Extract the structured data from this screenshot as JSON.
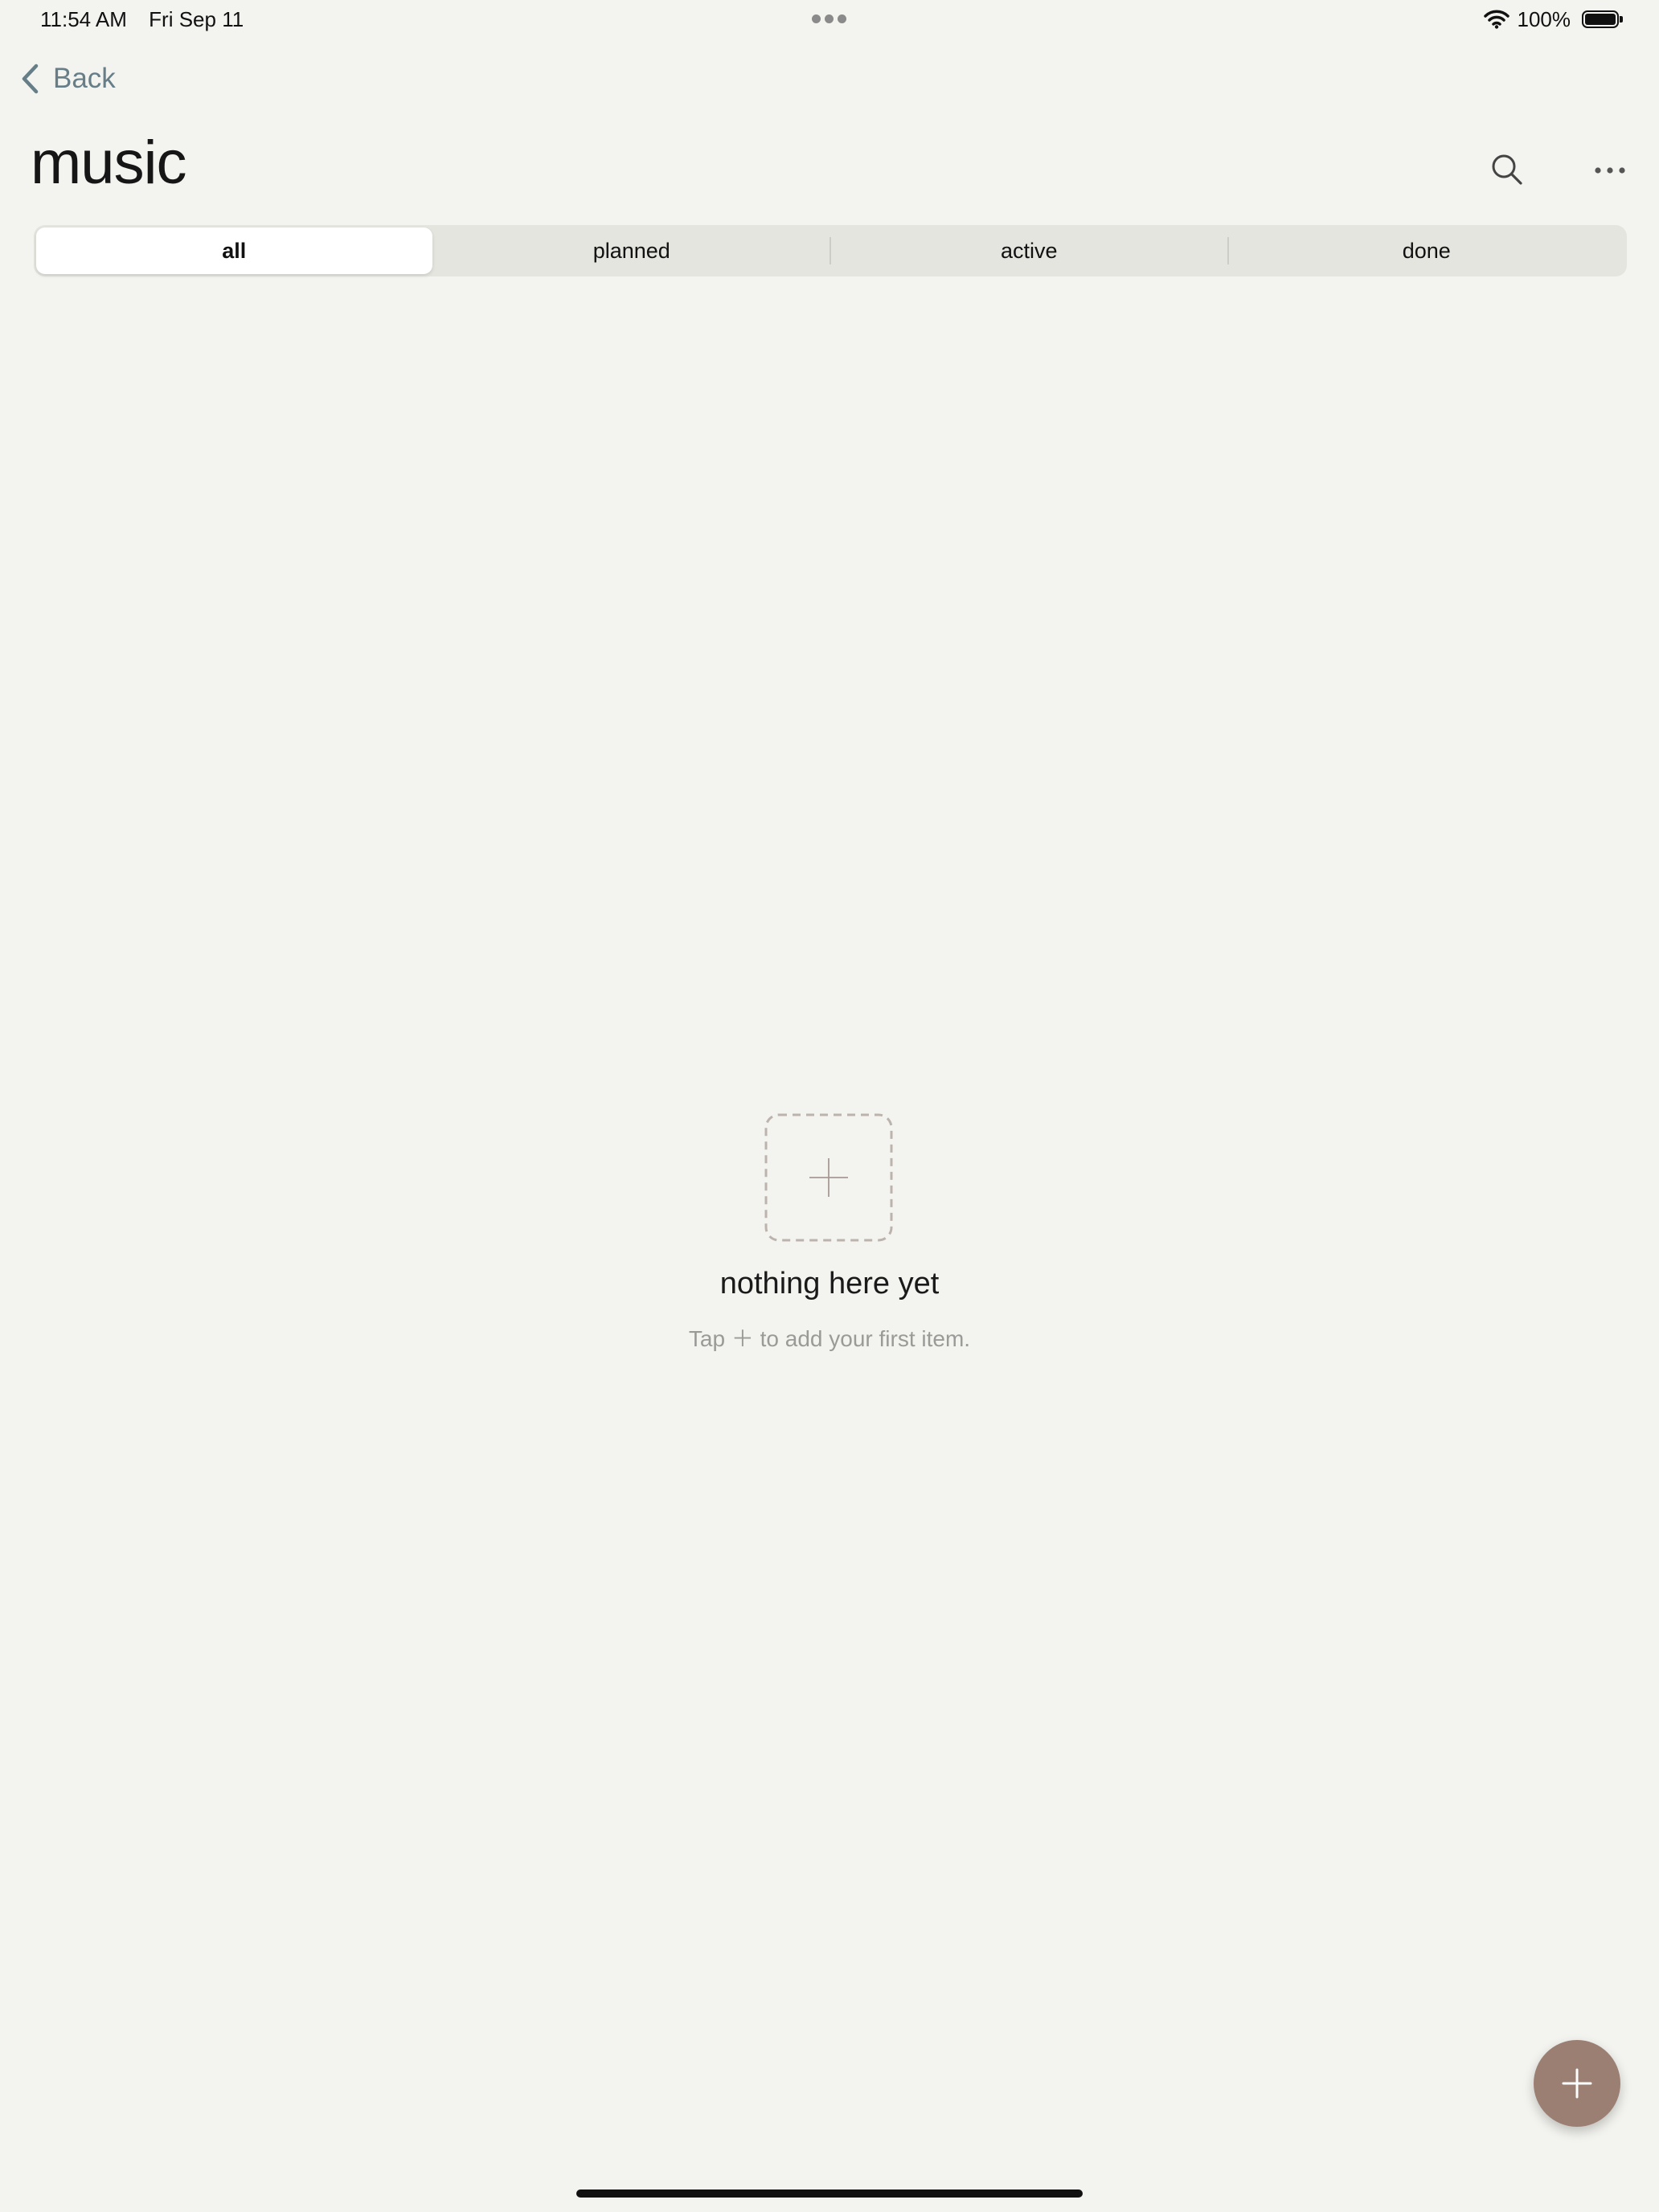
{
  "status_bar": {
    "time": "11:54 AM",
    "date": "Fri Sep 11",
    "battery_text": "100%"
  },
  "nav": {
    "back_label": "Back"
  },
  "header": {
    "title": "music"
  },
  "filter": {
    "segments": [
      "all",
      "planned",
      "active",
      "done"
    ],
    "selected": "all"
  },
  "empty_state": {
    "title": "nothing here yet",
    "subtitle": "Tap ＋ to add your first item."
  },
  "colors": {
    "background": "#f3f3ef",
    "accent": "#9c7f73",
    "back_link": "#667e88",
    "segmented_track": "#e5e5e0"
  },
  "icons": {
    "back": "chevron-left-icon",
    "search": "magnifier-icon",
    "more": "ellipsis-icon",
    "add": "plus-icon",
    "wifi": "wifi-icon",
    "battery": "battery-icon"
  }
}
